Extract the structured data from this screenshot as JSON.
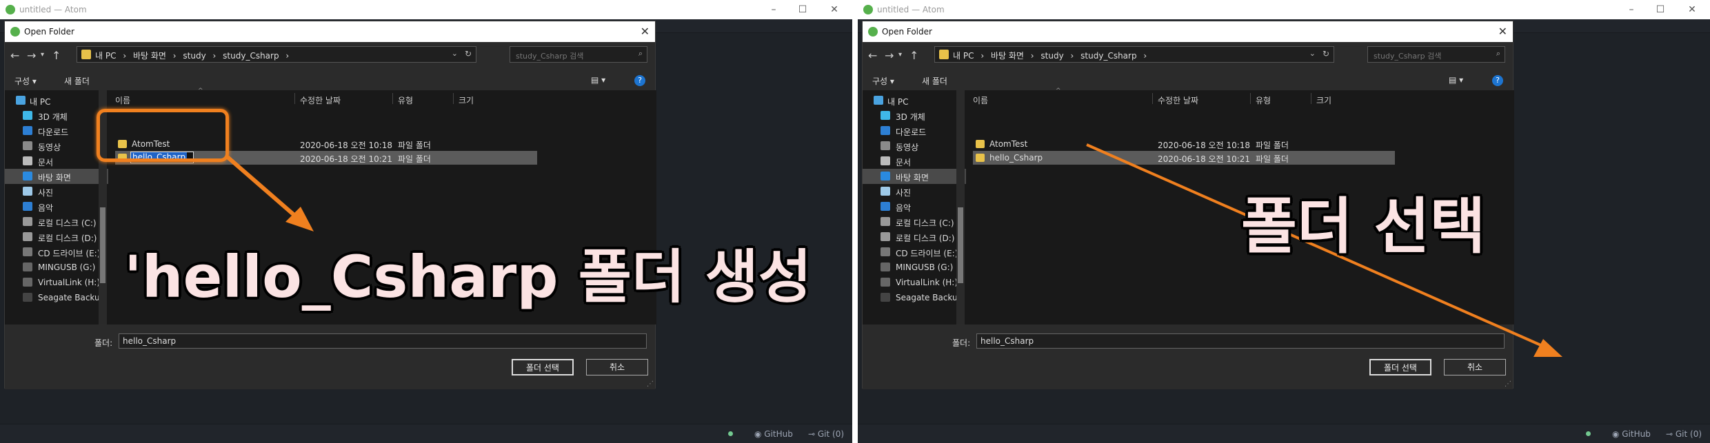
{
  "accent": "#f0801f",
  "panels": [
    {
      "window_title": "untitled — Atom",
      "dialog": {
        "title": "Open Folder",
        "breadcrumb": [
          "내 PC",
          "›",
          "바탕 화면",
          "›",
          "study",
          "›",
          "study_Csharp",
          "›"
        ],
        "search_placeholder": "study_Csharp 검색",
        "organize": "구성 ▾",
        "new_folder": "새 폴더",
        "view_icon": "▤ ▾",
        "columns": [
          "이름",
          "수정한 날짜",
          "유형",
          "크기"
        ],
        "nav_items": [
          "내 PC",
          "3D 개체",
          "다운로드",
          "동영상",
          "문서",
          "바탕 화면",
          "사진",
          "음악",
          "로컬 디스크 (C:)",
          "로컬 디스크 (D:)",
          "CD 드라이브 (E:)",
          "MINGUSB (G:)",
          "VirtualLink (H:)",
          "Seagate Backup"
        ],
        "rows": [
          {
            "name": "AtomTest",
            "date": "2020-06-18 오전 10:18",
            "type": "파일 폴더"
          },
          {
            "name": "hello_Csharp",
            "date": "2020-06-18 오전 10:21",
            "type": "파일 폴더"
          }
        ],
        "folder_label": "폴더:",
        "folder_value": "hello_Csharp",
        "select_button": "폴더 선택",
        "cancel_button": "취소"
      },
      "status": {
        "github": "GitHub",
        "git": "Git (0)"
      },
      "caption": "'hello_Csharp 폴더 생성"
    },
    {
      "window_title": "untitled — Atom",
      "dialog": {
        "title": "Open Folder",
        "breadcrumb": [
          "내 PC",
          "›",
          "바탕 화면",
          "›",
          "study",
          "›",
          "study_Csharp",
          "›"
        ],
        "search_placeholder": "study_Csharp 검색",
        "organize": "구성 ▾",
        "new_folder": "새 폴더",
        "view_icon": "▤ ▾",
        "columns": [
          "이름",
          "수정한 날짜",
          "유형",
          "크기"
        ],
        "nav_items": [
          "내 PC",
          "3D 개체",
          "다운로드",
          "동영상",
          "문서",
          "바탕 화면",
          "사진",
          "음악",
          "로컬 디스크 (C:)",
          "로컬 디스크 (D:)",
          "CD 드라이브 (E:)",
          "MINGUSB (G:)",
          "VirtualLink (H:)",
          "Seagate Backup"
        ],
        "rows": [
          {
            "name": "AtomTest",
            "date": "2020-06-18 오전 10:18",
            "type": "파일 폴더"
          },
          {
            "name": "hello_Csharp",
            "date": "2020-06-18 오전 10:21",
            "type": "파일 폴더"
          }
        ],
        "folder_label": "폴더:",
        "folder_value": "hello_Csharp",
        "select_button": "폴더 선택",
        "cancel_button": "취소"
      },
      "status": {
        "github": "GitHub",
        "git": "Git (0)"
      },
      "caption": "폴더 선택"
    }
  ]
}
